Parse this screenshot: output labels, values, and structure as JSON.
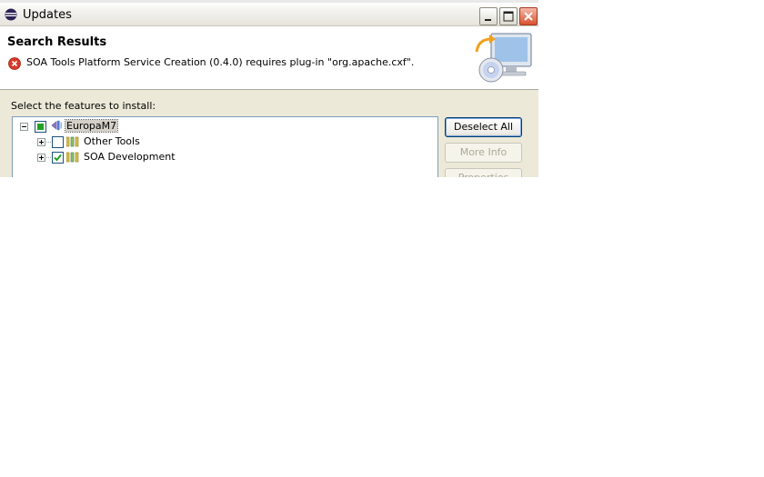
{
  "window": {
    "title": "Updates"
  },
  "header": {
    "title": "Search Results",
    "message": "SOA Tools Platform Service Creation (0.4.0) requires plug-in \"org.apache.cxf\"."
  },
  "features": {
    "prompt": "Select the features to install:",
    "tree": [
      {
        "label": "EuropaM7",
        "state": "partial",
        "expanded": true
      },
      {
        "label": "Other Tools",
        "state": "unchecked",
        "expanded": false
      },
      {
        "label": "SOA Development",
        "state": "checked",
        "expanded": false
      }
    ]
  },
  "buttons": {
    "deselect_all": "Deselect All",
    "more_info": "More Info",
    "properties": "Properties"
  },
  "colors": {
    "error": "#d83a28",
    "selection": "#d4d0c8",
    "checkbox_border": "#1c5180",
    "check_green": "#21a121"
  }
}
